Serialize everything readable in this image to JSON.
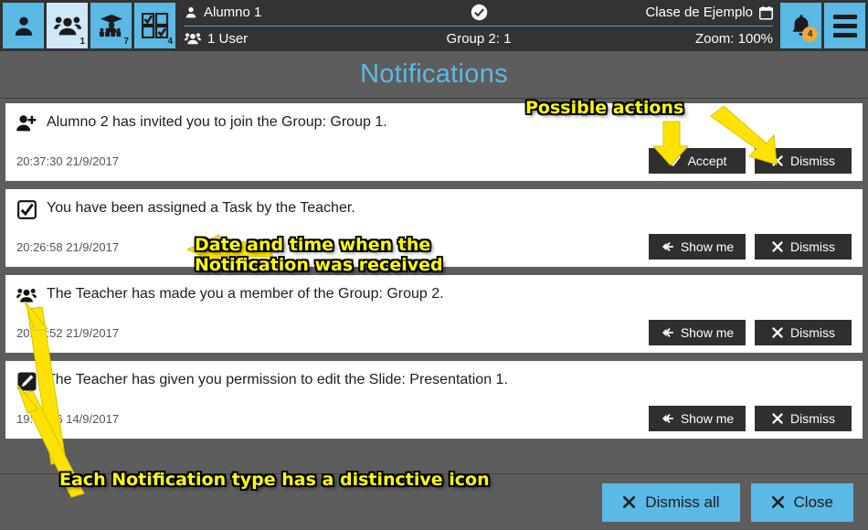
{
  "topbar": {
    "icons": [
      {
        "name": "user-icon",
        "badge": ""
      },
      {
        "name": "group-icon",
        "badge": "1"
      },
      {
        "name": "teacher-icon",
        "badge": "7"
      },
      {
        "name": "tasks-icon",
        "badge": "4"
      }
    ],
    "user_name": "Alumno 1",
    "user_count": "1 User",
    "center_status_icon": "check-circle-icon",
    "group_status": "Group 2: 1",
    "class_name": "Clase de Ejemplo",
    "calendar_icon": "calendar-icon",
    "zoom_label": "Zoom: 100%",
    "bell_badge": "4",
    "accent_color": "#5bb9e5",
    "badge_color": "#f0a93c"
  },
  "page_title": "Notifications",
  "notifications": [
    {
      "icon": "user-plus-icon",
      "message": "Alumno 2 has invited you to join the Group: Group 1.",
      "timestamp": "20:37:30 21/9/2017",
      "actions": [
        {
          "name": "accept-button",
          "label": "Accept",
          "icon": "check-icon"
        },
        {
          "name": "dismiss-button",
          "label": "Dismiss",
          "icon": "x-icon"
        }
      ]
    },
    {
      "icon": "checkbox-checked-icon",
      "message": "You have been assigned a Task by the Teacher.",
      "timestamp": "20:26:58 21/9/2017",
      "actions": [
        {
          "name": "show-me-button",
          "label": "Show me",
          "icon": "arrow-left-icon"
        },
        {
          "name": "dismiss-button",
          "label": "Dismiss",
          "icon": "x-icon"
        }
      ]
    },
    {
      "icon": "group-icon",
      "message": "The Teacher has made you a member of the Group: Group 2.",
      "timestamp": "20:10:52 21/9/2017",
      "actions": [
        {
          "name": "show-me-button",
          "label": "Show me",
          "icon": "arrow-left-icon"
        },
        {
          "name": "dismiss-button",
          "label": "Dismiss",
          "icon": "x-icon"
        }
      ]
    },
    {
      "icon": "pencil-edit-icon",
      "message": "The Teacher has given you permission to edit the Slide: Presentation 1.",
      "timestamp": "19:34:56 14/9/2017",
      "actions": [
        {
          "name": "show-me-button",
          "label": "Show me",
          "icon": "arrow-left-icon"
        },
        {
          "name": "dismiss-button",
          "label": "Dismiss",
          "icon": "x-icon"
        }
      ]
    }
  ],
  "footer": {
    "dismiss_all_label": "Dismiss all",
    "close_label": "Close"
  },
  "annotations": [
    {
      "name": "annotation-possible-actions",
      "text": "Possible actions"
    },
    {
      "name": "annotation-date-time",
      "text": "Date and time when the\nNotification was received"
    },
    {
      "name": "annotation-icon-type",
      "text": "Each Notification type has a distinctive icon"
    }
  ]
}
